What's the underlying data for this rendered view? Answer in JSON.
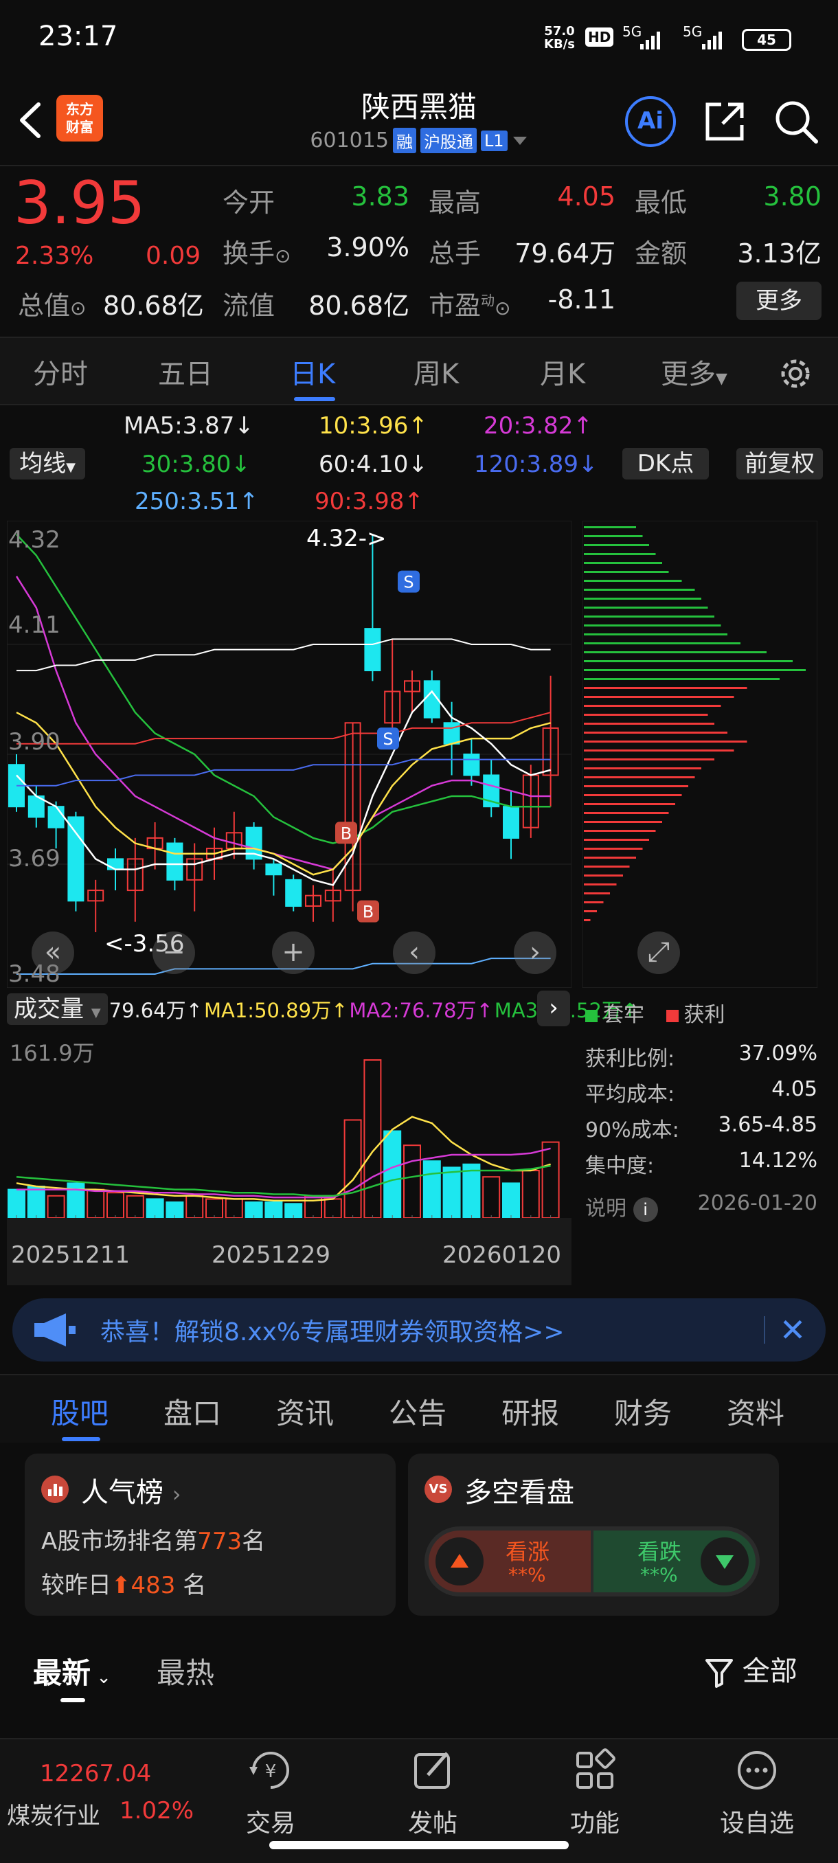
{
  "status": {
    "time": "23:17",
    "speed_value": "57.0",
    "speed_unit": "KB/s",
    "hd": "HD",
    "net1": "5G",
    "net2": "5G",
    "battery": "45"
  },
  "header": {
    "logo_line1": "东方",
    "logo_line2": "财富",
    "stock_name": "陕西黑猫",
    "stock_code": "601015",
    "tag_margin": "融",
    "tag_connect": "沪股通",
    "tag_level": "L1",
    "ai_label": "Ai"
  },
  "quote": {
    "price": "3.95",
    "change_pct": "2.33%",
    "change_amt": "0.09",
    "open_label": "今开",
    "open": "3.83",
    "high_label": "最高",
    "high": "4.05",
    "low_label": "最低",
    "low": "3.80",
    "turnover_label": "换手",
    "turnover": "3.90%",
    "volume_label": "总手",
    "volume": "79.64万",
    "amount_label": "金额",
    "amount": "3.13亿",
    "mktcap_label": "总值",
    "mktcap": "80.68亿",
    "float_label": "流值",
    "float_cap": "80.68亿",
    "pe_label": "市盈",
    "pe_sup": "动",
    "pe": "-8.11",
    "more_label": "更多"
  },
  "period_tabs": [
    "分时",
    "五日",
    "日K",
    "周K",
    "月K",
    "更多"
  ],
  "ma_legend": {
    "ma_chip": "均线",
    "ma5": "MA5:3.87↓",
    "ma10": "10:3.96↑",
    "ma20": "20:3.82↑",
    "ma30": "30:3.80↓",
    "ma60": "60:4.10↓",
    "ma120": "120:3.89↓",
    "ma250": "250:3.51↑",
    "ma90": "90:3.98↑",
    "dk_chip": "DK点",
    "adjust_chip": "前复权"
  },
  "kline": {
    "y_labels": [
      "4.32",
      "4.11",
      "3.90",
      "3.69",
      "3.48"
    ],
    "high_annotation": "4.32->",
    "low_annotation": "<-3.56",
    "signal_b": "B",
    "signal_s": "S",
    "colors": {
      "up": "#f23a3a",
      "down": "#1de7ef",
      "ma5": "#ffffff",
      "ma10": "#ffe24a",
      "ma20": "#d63ad6",
      "ma30": "#25c13d",
      "ma60": "#ffffff",
      "ma120": "#4a6cf0",
      "ma250": "#5fb0ff",
      "ma90": "#f23a3a"
    }
  },
  "volume": {
    "chip": "成交量",
    "vol": "79.64万↑",
    "ma1": "MA1:50.89万↑",
    "ma2": "MA2:76.78万↑",
    "ma3": "MA3:49.52万↑",
    "max_label": "161.9万",
    "dates": [
      "20251211",
      "20251229",
      "20260120"
    ]
  },
  "chips": {
    "legend_trapped": "套牢",
    "legend_profit": "获利",
    "profit_ratio_label": "获利比例:",
    "profit_ratio": "37.09%",
    "avg_cost_label": "平均成本:",
    "avg_cost": "4.05",
    "cost90_label": "90%成本:",
    "cost90": "3.65-4.85",
    "concentration_label": "集中度:",
    "concentration": "14.12%",
    "note_label": "说明",
    "date": "2026-01-20"
  },
  "banner": {
    "text": "恭喜！解锁8.xx%专属理财券领取资格>>"
  },
  "section_tabs": [
    "股吧",
    "盘口",
    "资讯",
    "公告",
    "研报",
    "财务",
    "资料"
  ],
  "popularity": {
    "title": "人气榜",
    "rank_prefix": "A股市场排名第",
    "rank": "773",
    "rank_suffix": "名",
    "change_prefix": "较昨日",
    "change": "483",
    "change_suffix": "名"
  },
  "longshort": {
    "title": "多空看盘",
    "up_label": "看涨",
    "up_value": "**%",
    "down_label": "看跌",
    "down_value": "**%"
  },
  "feed": {
    "latest": "最新",
    "hot": "最热",
    "filter": "全部"
  },
  "bottom": {
    "index_value": "12267.04",
    "index_name": "煤炭行业",
    "index_pct": "1.02%",
    "trade": "交易",
    "post": "发帖",
    "functions": "功能",
    "watchlist": "设自选"
  }
}
